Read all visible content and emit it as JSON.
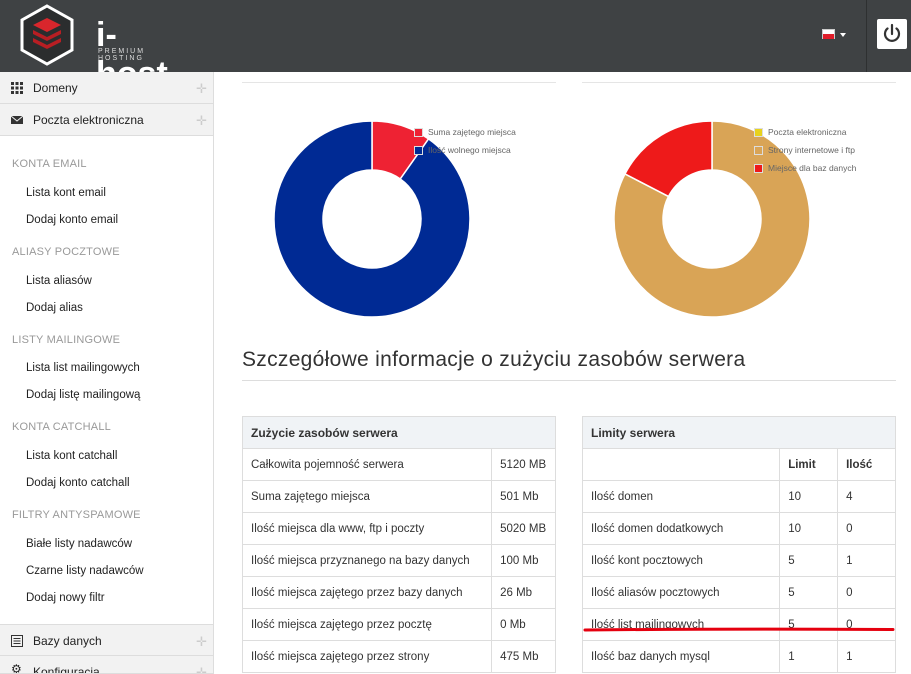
{
  "header": {
    "brand": "i-host",
    "brand_sub": "PREMIUM HOSTING",
    "language_flag": "pl-flag-icon",
    "power_icon": "power-icon"
  },
  "sidebar": {
    "main_items": [
      {
        "label": "Domeny",
        "icon": "grid-icon"
      },
      {
        "label": "Poczta elektroniczna",
        "icon": "envelope-icon"
      },
      {
        "label": "Bazy danych",
        "icon": "list-icon"
      },
      {
        "label": "Konfiguracja",
        "icon": "gear-icon"
      }
    ],
    "groups": [
      {
        "heading": "KONTA EMAIL",
        "items": [
          "Lista kont email",
          "Dodaj konto email"
        ]
      },
      {
        "heading": "ALIASY POCZTOWE",
        "items": [
          "Lista aliasów",
          "Dodaj alias"
        ]
      },
      {
        "heading": "LISTY MAILINGOWE",
        "items": [
          "Lista list mailingowych",
          "Dodaj listę mailingową"
        ]
      },
      {
        "heading": "KONTA CATCHALL",
        "items": [
          "Lista kont catchall",
          "Dodaj konto catchall"
        ]
      },
      {
        "heading": "FILTRY ANTYSPAMOWE",
        "items": [
          "Białe listy nadawców",
          "Czarne listy nadawców",
          "Dodaj nowy filtr"
        ]
      }
    ]
  },
  "charts": {
    "left": {
      "legend": [
        "Suma zajętego miejsca",
        "Ilość wolnego miejsca"
      ],
      "colors": [
        "#ee2233",
        "#002a94"
      ]
    },
    "right": {
      "legend": [
        "Poczta elektroniczna",
        "Strony internetowe i ftp",
        "Miejsce dla baz danych"
      ],
      "colors": [
        "#e8d21c",
        "#d9a456",
        "#ee1a1a"
      ]
    }
  },
  "chart_data": [
    {
      "type": "pie",
      "categories": [
        "Suma zajętego miejsca",
        "Ilość wolnego miejsca"
      ],
      "values": [
        501,
        4619
      ]
    },
    {
      "type": "pie",
      "categories": [
        "Poczta elektroniczna",
        "Strony internetowe i ftp",
        "Miejsce dla baz danych"
      ],
      "values": [
        0,
        475,
        100
      ]
    }
  ],
  "main": {
    "section_title": "Szczegółowe informacje o zużyciu zasobów serwera",
    "usage_table": {
      "title": "Zużycie zasobów serwera",
      "rows": [
        [
          "Całkowita pojemność serwera",
          "5120 MB"
        ],
        [
          "Suma zajętego miejsca",
          "501 Mb"
        ],
        [
          "Ilość miejsca dla www, ftp i poczty",
          "5020 MB"
        ],
        [
          "Ilość miejsca przyznanego na bazy danych",
          "100 Mb"
        ],
        [
          "Ilość miejsca zajętego przez bazy danych",
          "26 Mb"
        ],
        [
          "Ilość miejsca zajętego przez pocztę",
          "0 Mb"
        ],
        [
          "Ilość miejsca zajętego przez strony",
          "475 Mb"
        ]
      ]
    },
    "limits_table": {
      "title": "Limity serwera",
      "col_limit": "Limit",
      "col_count": "Ilość",
      "rows": [
        [
          "Ilość domen",
          "10",
          "4"
        ],
        [
          "Ilość domen dodatkowych",
          "10",
          "0"
        ],
        [
          "Ilość kont pocztowych",
          "5",
          "1"
        ],
        [
          "Ilość aliasów pocztowych",
          "5",
          "0"
        ],
        [
          "Ilość list mailingowych",
          "5",
          "0"
        ],
        [
          "Ilość baz danych mysql",
          "1",
          "1"
        ]
      ]
    }
  }
}
